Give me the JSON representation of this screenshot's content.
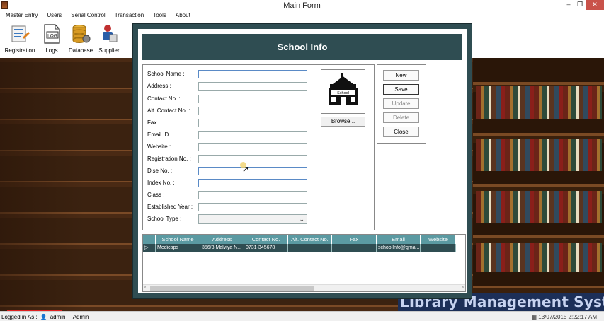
{
  "window": {
    "title": "Main Form"
  },
  "menu": [
    "Master Entry",
    "Users",
    "Serial Control",
    "Transaction",
    "Tools",
    "About"
  ],
  "toolbar": [
    {
      "label": "Registration",
      "icon": "registration-icon"
    },
    {
      "label": "Logs",
      "icon": "log-icon",
      "icon_text": "LOG"
    },
    {
      "label": "Database",
      "icon": "database-icon"
    },
    {
      "label": "Supplier",
      "icon": "supplier-icon"
    }
  ],
  "school_form": {
    "title": "School Info",
    "fields": [
      {
        "label": "School Name :",
        "value": ""
      },
      {
        "label": "Address :",
        "value": ""
      },
      {
        "label": "Contact No. :",
        "value": ""
      },
      {
        "label": "Alt. Contact No. :",
        "value": ""
      },
      {
        "label": "Fax :",
        "value": ""
      },
      {
        "label": "Email ID :",
        "value": ""
      },
      {
        "label": "Website :",
        "value": ""
      },
      {
        "label": "Registration No. :",
        "value": ""
      },
      {
        "label": "Dise No. :",
        "value": ""
      },
      {
        "label": "Index No. :",
        "value": ""
      },
      {
        "label": "Class :",
        "value": ""
      },
      {
        "label": "Established Year :",
        "value": ""
      },
      {
        "label": "School Type :",
        "value": ""
      }
    ],
    "logo_text": "School",
    "browse_label": "Browse...",
    "buttons": [
      "New",
      "Save",
      "Update",
      "Delete",
      "Close"
    ]
  },
  "grid": {
    "columns": [
      "School Name",
      "Address",
      "Contact No.",
      "Alt. Contact No.",
      "Fax",
      "Email",
      "Website"
    ],
    "rows": [
      [
        "Medicaps",
        "356/3 Malviya N...",
        "0731-345678",
        "",
        "",
        "schoolInfo@gma...",
        ""
      ]
    ]
  },
  "banner": "Library Management System",
  "status": {
    "logged_in_label": "Logged in As :",
    "user": "admin",
    "role": "Admin",
    "datetime": "13/07/2015 2:22:17 AM"
  },
  "colors": {
    "accent": "#2f4d52",
    "grid_header": "#5b9aa2",
    "close": "#c9524a"
  }
}
